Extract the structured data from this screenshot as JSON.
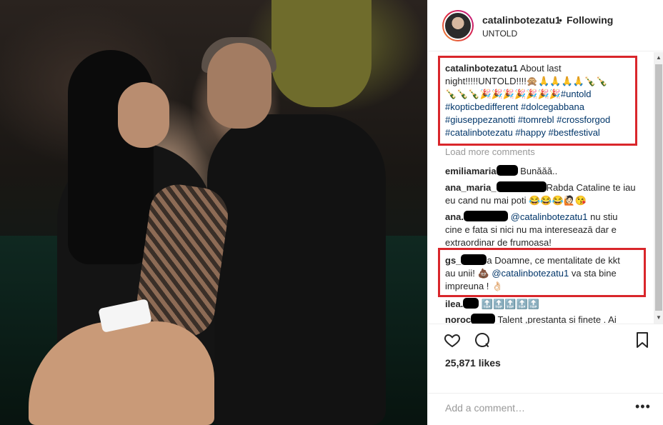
{
  "post": {
    "username": "catalinbotezatu1",
    "dot": "•",
    "follow_status": "Following",
    "location": "UNTOLD",
    "caption_lines": [
      "About last",
      "night!!!!!UNTOLD!!!!🙊🙏🙏🙏🙏🍾🍾",
      "🍾🍾🍾🎉🎉🎉🎉🎉🎉🎉",
      "#kopticbedifferent #dolcegabbana",
      "#giuseppezanotti #tomrebl #crossforgod",
      "#catalinbotezatu #happy #bestfestival"
    ],
    "caption_hashtag_line2": "#untold"
  },
  "comments": {
    "load_more": "Load more comments",
    "items": [
      {
        "user": "emiliamaria",
        "text": "Bunăăă.."
      },
      {
        "user": "ana_maria_",
        "text_line1": "Rabda Cataline te iau",
        "text_line2": "eu cand nu mai poti 😂😂😂🙋🏻😘"
      },
      {
        "user": "ana.",
        "mention": "@catalinbotezatu1",
        "text_line1": "nu stiu",
        "text_line2": "cine e fata si nici nu ma intereseazā dar e",
        "text_line3": "extraordinar de frumoasa!"
      },
      {
        "user": "gs_",
        "text_line1": "a Doamne, ce mentalitate de kkt",
        "text_line2a": "au unii! 💩",
        "mention": "@catalinbotezatu1",
        "text_line2b": "va sta bine",
        "text_line3": "impreuna ! 👌🏻"
      },
      {
        "user": "ilea.",
        "text": "🔝🔝🔝🔝🔝"
      },
      {
        "user": "noroc",
        "text": "Talent ,prestanta si finete . Ai"
      }
    ]
  },
  "actions": {
    "likes": "25,871 likes",
    "icons": [
      "heart-icon",
      "comment-icon",
      "bookmark-icon"
    ]
  },
  "add_comment": {
    "placeholder": "Add a comment…",
    "more": "•••"
  },
  "colors": {
    "highlight_box": "#d9262b",
    "link": "#003569",
    "muted": "#999999"
  }
}
